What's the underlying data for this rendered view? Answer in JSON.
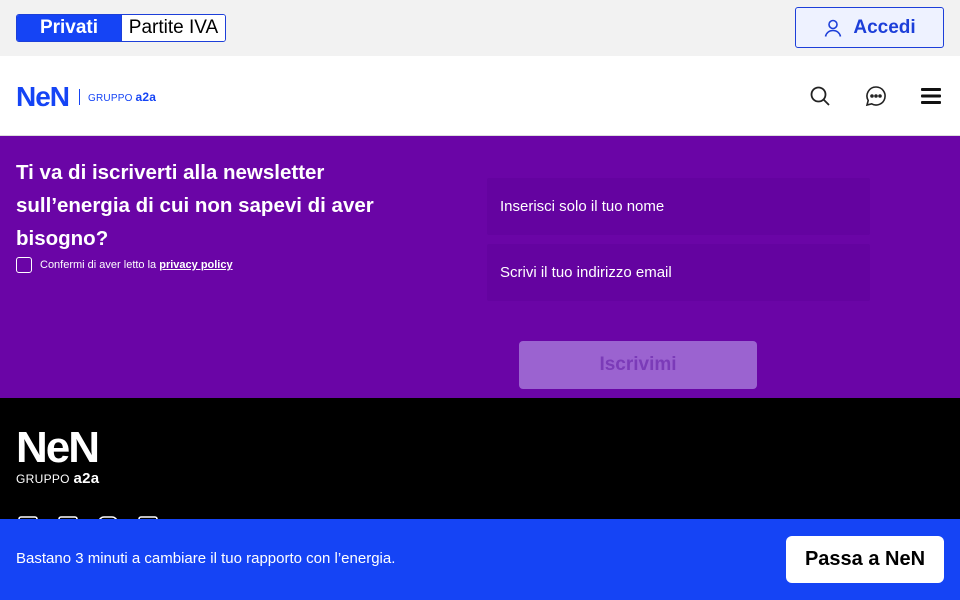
{
  "topbar": {
    "segments": [
      {
        "label": "Privati",
        "active": true
      },
      {
        "label": "Partite IVA",
        "active": false
      }
    ],
    "login_label": "Accedi",
    "login_icon": "user-icon"
  },
  "header": {
    "logo_mark": "NeN",
    "logo_group": "GRUPPO",
    "logo_brand": "a2a",
    "icons": [
      "search-icon",
      "chat-icon",
      "menu-icon"
    ]
  },
  "newsletter": {
    "title": "Ti va di iscriverti alla newsletter sull’energia di cui non sapevi di aver bisogno?",
    "consent_prefix": "Confermi di aver letto la",
    "consent_link": "privacy policy",
    "name_placeholder": "Inserisci solo il tuo nome",
    "email_placeholder": "Scrivi il tuo indirizzo email",
    "submit_label": "Iscrivimi"
  },
  "footer": {
    "logo_mark": "NeN",
    "logo_group": "GRUPPO",
    "logo_brand": "a2a",
    "social_icons": [
      "facebook-icon",
      "linkedin-icon",
      "instagram-icon",
      "tiktok-icon"
    ]
  },
  "cta": {
    "text": "Bastano 3 minuti a cambiare il tuo rapporto con l’energia.",
    "button_label": "Passa a NeN"
  },
  "colors": {
    "brand_blue": "#1544f5",
    "newsletter_purple": "#6a05a6",
    "footer_black": "#000000"
  }
}
